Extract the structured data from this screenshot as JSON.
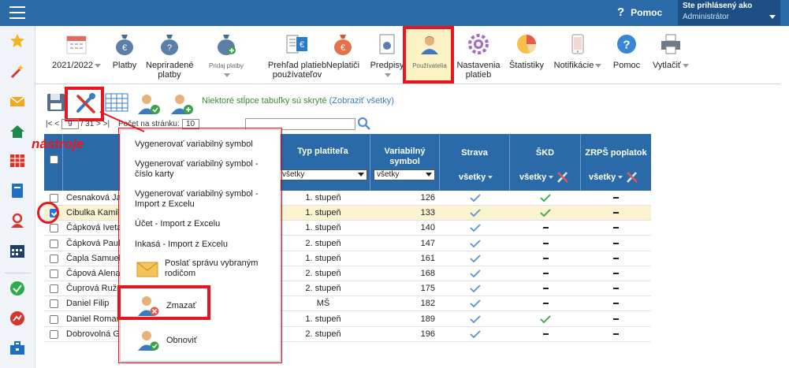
{
  "topbar": {
    "help_label": "Pomoc",
    "user_line1": "Ste prihlásený ako",
    "user_line2": "Administrátor"
  },
  "sidebar": {
    "icons": [
      "star-icon",
      "magic-wand-icon",
      "mail-icon",
      "home-icon",
      "calendar-grid-icon",
      "book-icon",
      "user-icon",
      "calendar-icon",
      "check-circle-icon",
      "chart-circle-icon",
      "briefcase-icon"
    ]
  },
  "ribbon": {
    "items": [
      {
        "label": "2021/2022",
        "dropdown": true,
        "icon": "calendar-icon"
      },
      {
        "label": "Platby",
        "icon": "money-bag-icon"
      },
      {
        "label": "Nepriradené platby",
        "icon": "money-bag-question-icon"
      },
      {
        "label": "Pridaj platby",
        "dropdown": true,
        "icon": "money-bag-add-icon"
      },
      {
        "label": "Prehľad platieb používateľov",
        "icon": "euro-document-icon"
      },
      {
        "label": "Neplatiči",
        "icon": "money-bag-alert-icon"
      },
      {
        "label": "Predpisy",
        "dropdown": true,
        "icon": "document-euro-icon"
      },
      {
        "label": "Používatelia",
        "icon": "user-icon"
      },
      {
        "label": "Nastavenia platieb",
        "icon": "settings-icon"
      },
      {
        "label": "Štatistiky",
        "icon": "pie-chart-icon"
      },
      {
        "label": "Notifikácie",
        "dropdown": true,
        "icon": "phone-icon"
      },
      {
        "label": "Pomoc",
        "icon": "help-icon"
      },
      {
        "label": "Vytlačiť",
        "dropdown": true,
        "icon": "printer-icon"
      }
    ]
  },
  "toolbar": {
    "notice": "Niektoré stĺpce tabuľky sú skryté",
    "notice_link": "(Zobraziť všetky)"
  },
  "pager": {
    "first": "|<",
    "prev": "<",
    "current": "9",
    "of": "/ 31",
    "next": ">",
    "last": ">|",
    "per_page_label": "Počet na stránku:",
    "per_page_value": "10"
  },
  "annotation": {
    "label": "nástroje"
  },
  "table": {
    "headers": {
      "type": "Typ platiteľa",
      "vs": "Variabilný symbol",
      "strava": "Strava",
      "skd": "ŠKD",
      "zrps": "ZRPŠ poplatok"
    },
    "filters": {
      "type": "všetky",
      "vs": "všetky",
      "strava": "všetky",
      "skd": "všetky",
      "zrps": "všetky"
    },
    "rows": [
      {
        "name": "Cesnaková Ja",
        "type": "1. stupeň",
        "vs": "126",
        "strava": "check",
        "skd": "check",
        "zrps": "dash",
        "checked": false
      },
      {
        "name": "Cibulka Kamil",
        "type": "1. stupeň",
        "vs": "133",
        "strava": "check",
        "skd": "check",
        "zrps": "dash",
        "checked": true
      },
      {
        "name": "Čápková Iveta",
        "type": "1. stupeň",
        "vs": "140",
        "strava": "check",
        "skd": "dash",
        "zrps": "dash",
        "checked": false
      },
      {
        "name": "Čápková Paul",
        "type": "2. stupeň",
        "vs": "147",
        "strava": "check",
        "skd": "dash",
        "zrps": "dash",
        "checked": false
      },
      {
        "name": "Čapla Samuel",
        "type": "1. stupeň",
        "vs": "161",
        "strava": "check",
        "skd": "dash",
        "zrps": "dash",
        "checked": false
      },
      {
        "name": "Čápová Alena",
        "type": "2. stupeň",
        "vs": "168",
        "strava": "check",
        "skd": "dash",
        "zrps": "dash",
        "checked": false
      },
      {
        "name": "Čuprová Ruže",
        "type": "2. stupeň",
        "vs": "175",
        "strava": "check",
        "skd": "dash",
        "zrps": "dash",
        "checked": false
      },
      {
        "name": "Daniel Filip",
        "type": "MŠ",
        "vs": "182",
        "strava": "check",
        "skd": "dash",
        "zrps": "dash",
        "checked": false
      },
      {
        "name": "Daniel Roman",
        "type": "1. stupeň",
        "vs": "189",
        "strava": "check",
        "skd": "check",
        "zrps": "dash",
        "checked": false
      },
      {
        "name": "Dobrovolná G",
        "type": "2. stupeň",
        "vs": "196",
        "strava": "check",
        "skd": "dash",
        "zrps": "dash",
        "checked": false
      }
    ]
  },
  "menu": {
    "items": [
      {
        "label": "Vygenerovať variabilný symbol"
      },
      {
        "label": "Vygenerovať variabilný symbol - číslo karty"
      },
      {
        "label": "Vygenerovať variabilný symbol - Import z Excelu"
      },
      {
        "label": "Účet - Import z Excelu"
      },
      {
        "label": "Inkasá - Import z Excelu"
      },
      {
        "label": "Poslať správu vybraným rodičom",
        "icon": "envelope-icon"
      },
      {
        "label": "Zmazať",
        "icon": "user-delete-icon"
      },
      {
        "label": "Obnoviť",
        "icon": "user-restore-icon"
      }
    ]
  },
  "colors": {
    "header_blue": "#2a6aa8",
    "highlight_red": "#e8171f",
    "selected_row": "#fbf3cf",
    "check_blue": "#5b8fd0",
    "check_green": "#3aa04a"
  }
}
